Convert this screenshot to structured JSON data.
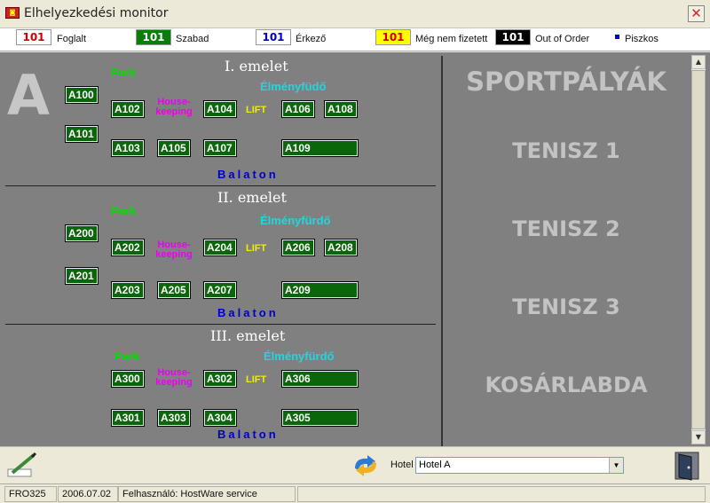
{
  "window": {
    "title": "Elhelyezkedési monitor"
  },
  "legend": [
    {
      "num": "101",
      "label": "Foglalt",
      "bg": "#ffffff",
      "fg": "#cc0000"
    },
    {
      "num": "101",
      "label": "Szabad",
      "bg": "#0b7d0b",
      "fg": "#ffffff"
    },
    {
      "num": "101",
      "label": "Érkező",
      "bg": "#ffffff",
      "fg": "#0000cc"
    },
    {
      "num": "101",
      "label": "Még nem fizetett",
      "bg": "#ffff00",
      "fg": "#cc0000"
    },
    {
      "num": "101",
      "label": "Out of Order",
      "bg": "#000000",
      "fg": "#ffffff"
    },
    {
      "label": "Piszkos",
      "marker_color": "#0000cc"
    }
  ],
  "building": {
    "letter": "A"
  },
  "floors": [
    {
      "title": "I. emelet",
      "park": "Park",
      "wellness": "Élményfüdő",
      "housekeeping": [
        "House-",
        "keeping"
      ],
      "lift": "LIFT",
      "lake": "Balaton",
      "rooms": [
        "A100",
        "A101",
        "A102",
        "A103",
        "A104",
        "A105",
        "A106",
        "A107",
        "A108",
        "A109"
      ]
    },
    {
      "title": "II. emelet",
      "park": "Park",
      "wellness": "Élményfürdő",
      "housekeeping": [
        "House-",
        "keeping"
      ],
      "lift": "LIFT",
      "lake": "Balaton",
      "rooms": [
        "A200",
        "A201",
        "A202",
        "A203",
        "A204",
        "A205",
        "A206",
        "A207",
        "A208",
        "A209"
      ]
    },
    {
      "title": "III. emelet",
      "park": "Park",
      "wellness": "Élményfürdő",
      "housekeeping": [
        "House-",
        "keeping"
      ],
      "lift": "LIFT",
      "lake": "Balaton",
      "rooms": [
        "A300",
        "A301",
        "A302",
        "A303",
        "A304",
        "A305",
        "A306"
      ]
    }
  ],
  "sports": [
    "SPORTPÁLYÁK",
    "TENISZ 1",
    "TENISZ 2",
    "TENISZ 3",
    "KOSÁRLABDA"
  ],
  "toolbar": {
    "hotel_label": "Hotel",
    "hotel_value": "Hotel A"
  },
  "status": {
    "code": "FRO325",
    "date": "2006.07.02",
    "user": "Felhasználó: HostWare service"
  },
  "icons": [
    "app-icon",
    "close-icon",
    "edit-pencil-icon",
    "refresh-icon",
    "exit-door-icon",
    "scroll-up-icon",
    "scroll-down-icon",
    "dropdown-arrow-icon"
  ]
}
